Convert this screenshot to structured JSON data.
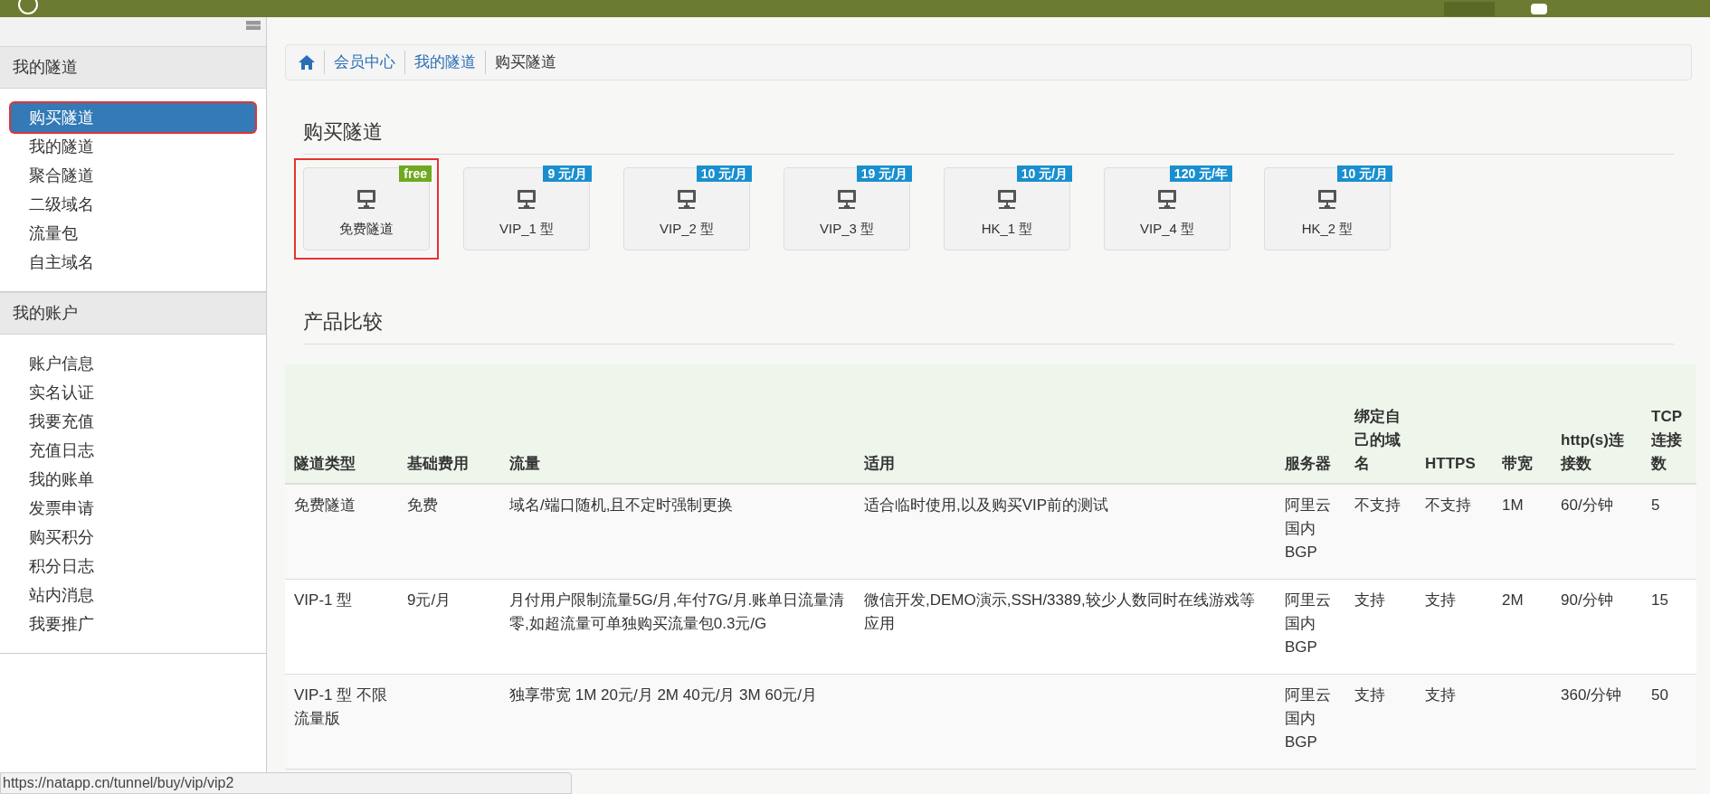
{
  "breadcrumb": [
    "会员中心",
    "我的隧道",
    "购买隧道"
  ],
  "sidebar": [
    {
      "title": "我的隧道",
      "items": [
        {
          "label": "购买隧道",
          "selected": true,
          "highlighted": true
        },
        {
          "label": "我的隧道",
          "selected": false,
          "highlighted": false
        },
        {
          "label": "聚合隧道",
          "selected": false,
          "highlighted": false
        },
        {
          "label": "二级域名",
          "selected": false,
          "highlighted": false
        },
        {
          "label": "流量包",
          "selected": false,
          "highlighted": false
        },
        {
          "label": "自主域名",
          "selected": false,
          "highlighted": false
        }
      ]
    },
    {
      "title": "我的账户",
      "items": [
        {
          "label": "账户信息",
          "selected": false,
          "highlighted": false
        },
        {
          "label": "实名认证",
          "selected": false,
          "highlighted": false
        },
        {
          "label": "我要充值",
          "selected": false,
          "highlighted": false
        },
        {
          "label": "充值日志",
          "selected": false,
          "highlighted": false
        },
        {
          "label": "我的账单",
          "selected": false,
          "highlighted": false
        },
        {
          "label": "发票申请",
          "selected": false,
          "highlighted": false
        },
        {
          "label": "购买积分",
          "selected": false,
          "highlighted": false
        },
        {
          "label": "积分日志",
          "selected": false,
          "highlighted": false
        },
        {
          "label": "站内消息",
          "selected": false,
          "highlighted": false
        },
        {
          "label": "我要推广",
          "selected": false,
          "highlighted": false
        }
      ]
    }
  ],
  "buy_heading": "购买隧道",
  "plans": [
    {
      "label": "免费隧道",
      "badge": "free",
      "color": "#6ea91f",
      "highlighted": true
    },
    {
      "label": "VIP_1 型",
      "badge": "9 元/月",
      "color": "#1a8fcf",
      "highlighted": false
    },
    {
      "label": "VIP_2 型",
      "badge": "10 元/月",
      "color": "#1a8fcf",
      "highlighted": false
    },
    {
      "label": "VIP_3 型",
      "badge": "19 元/月",
      "color": "#1a8fcf",
      "highlighted": false
    },
    {
      "label": "HK_1 型",
      "badge": "10 元/月",
      "color": "#1a8fcf",
      "highlighted": false
    },
    {
      "label": "VIP_4 型",
      "badge": "120 元/年",
      "color": "#1a8fcf",
      "highlighted": false
    },
    {
      "label": "HK_2 型",
      "badge": "10 元/月",
      "color": "#1a8fcf",
      "highlighted": false
    }
  ],
  "compare_heading": "产品比较",
  "table": {
    "columns": [
      "隧道类型",
      "基础费用",
      "流量",
      "适用",
      "服务器",
      "绑定自己的域名",
      "HTTPS",
      "带宽",
      "http(s)连接数",
      "TCP连接数"
    ],
    "rows": [
      [
        "免费隧道",
        "免费",
        "域名/端口随机,且不定时强制更换",
        "适合临时使用,以及购买VIP前的测试",
        "阿里云国内BGP",
        "不支持",
        "不支持",
        "1M",
        "60/分钟",
        "5"
      ],
      [
        "VIP-1 型",
        "9元/月",
        "月付用户限制流量5G/月,年付7G/月.账单日流量清零,如超流量可单独购买流量包0.3元/G",
        "微信开发,DEMO演示,SSH/3389,较少人数同时在线游戏等应用",
        "阿里云国内BGP",
        "支持",
        "支持",
        "2M",
        "90/分钟",
        "15"
      ],
      [
        "VIP-1 型 不限流量版",
        "",
        "独享带宽 1M 20元/月 2M 40元/月 3M 60元/月",
        "",
        "阿里云国内BGP",
        "支持",
        "支持",
        "",
        "360/分钟",
        "50"
      ]
    ]
  },
  "status_url": "https://natapp.cn/tunnel/buy/vip/vip2"
}
